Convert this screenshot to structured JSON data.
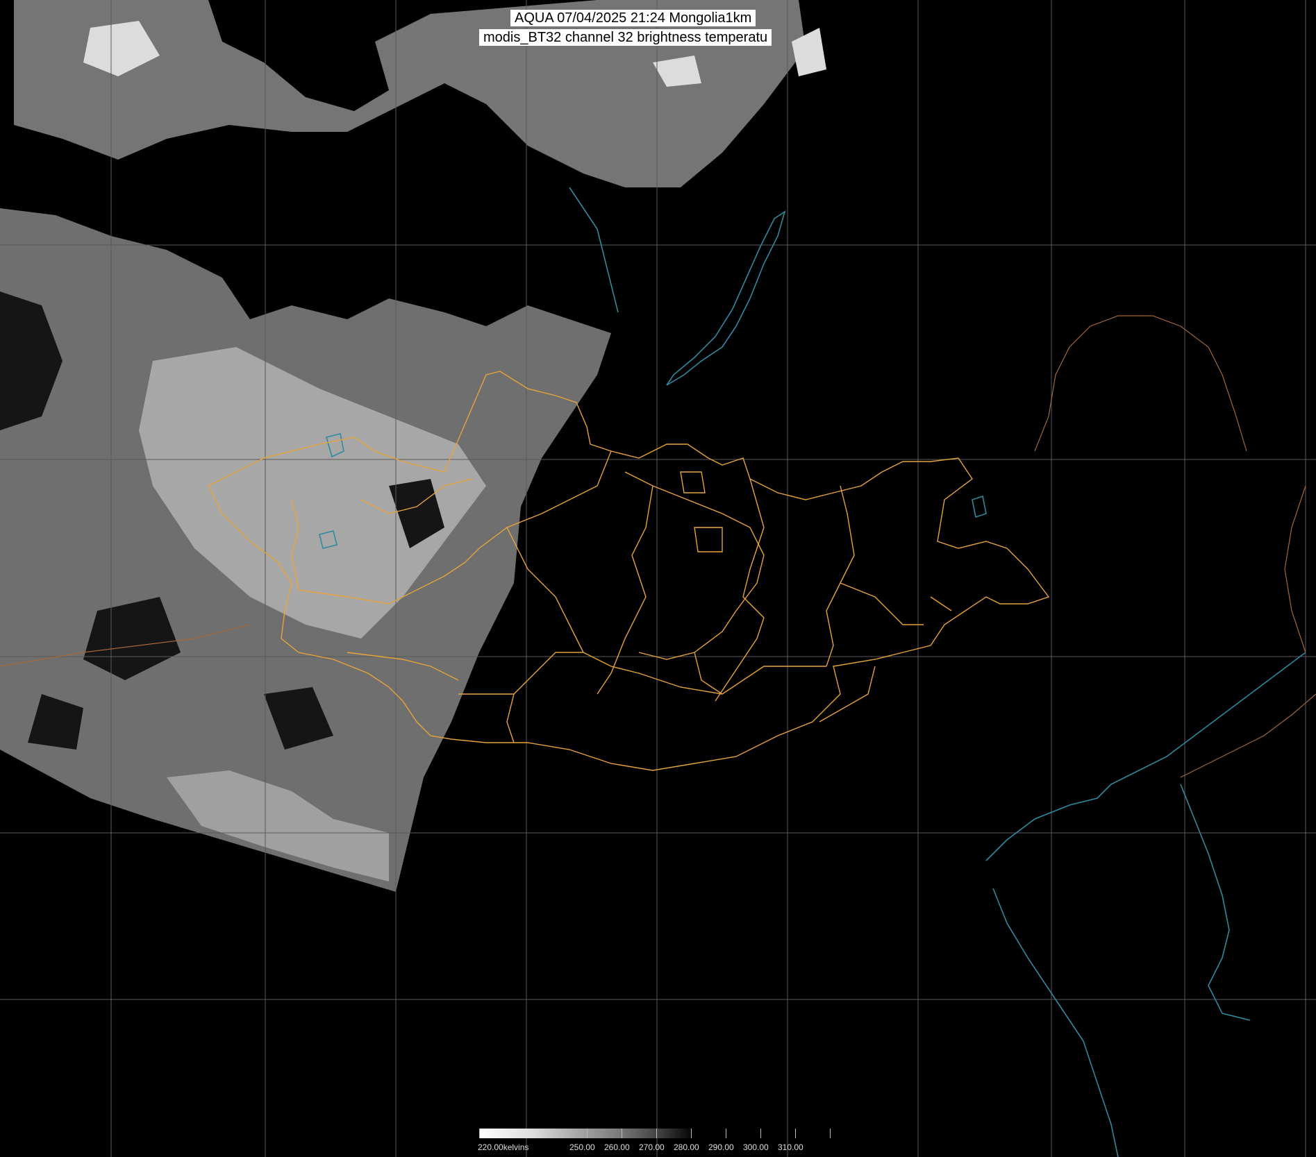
{
  "header": {
    "title_line1": "AQUA 07/04/2025 21:24 Mongolia1km",
    "title_line2": "modis_BT32 channel 32 brightness temperatu"
  },
  "legend": {
    "unit_label": "220.00kelvins",
    "ticks": [
      "250.00",
      "260.00",
      "270.00",
      "280.00",
      "290.00",
      "300.00",
      "310.00"
    ]
  },
  "colors": {
    "background": "#000000",
    "graticule": "#5a5a5a",
    "admin_borders": "#e8a33a",
    "coast_and_lakes": "#2f8aa0"
  }
}
